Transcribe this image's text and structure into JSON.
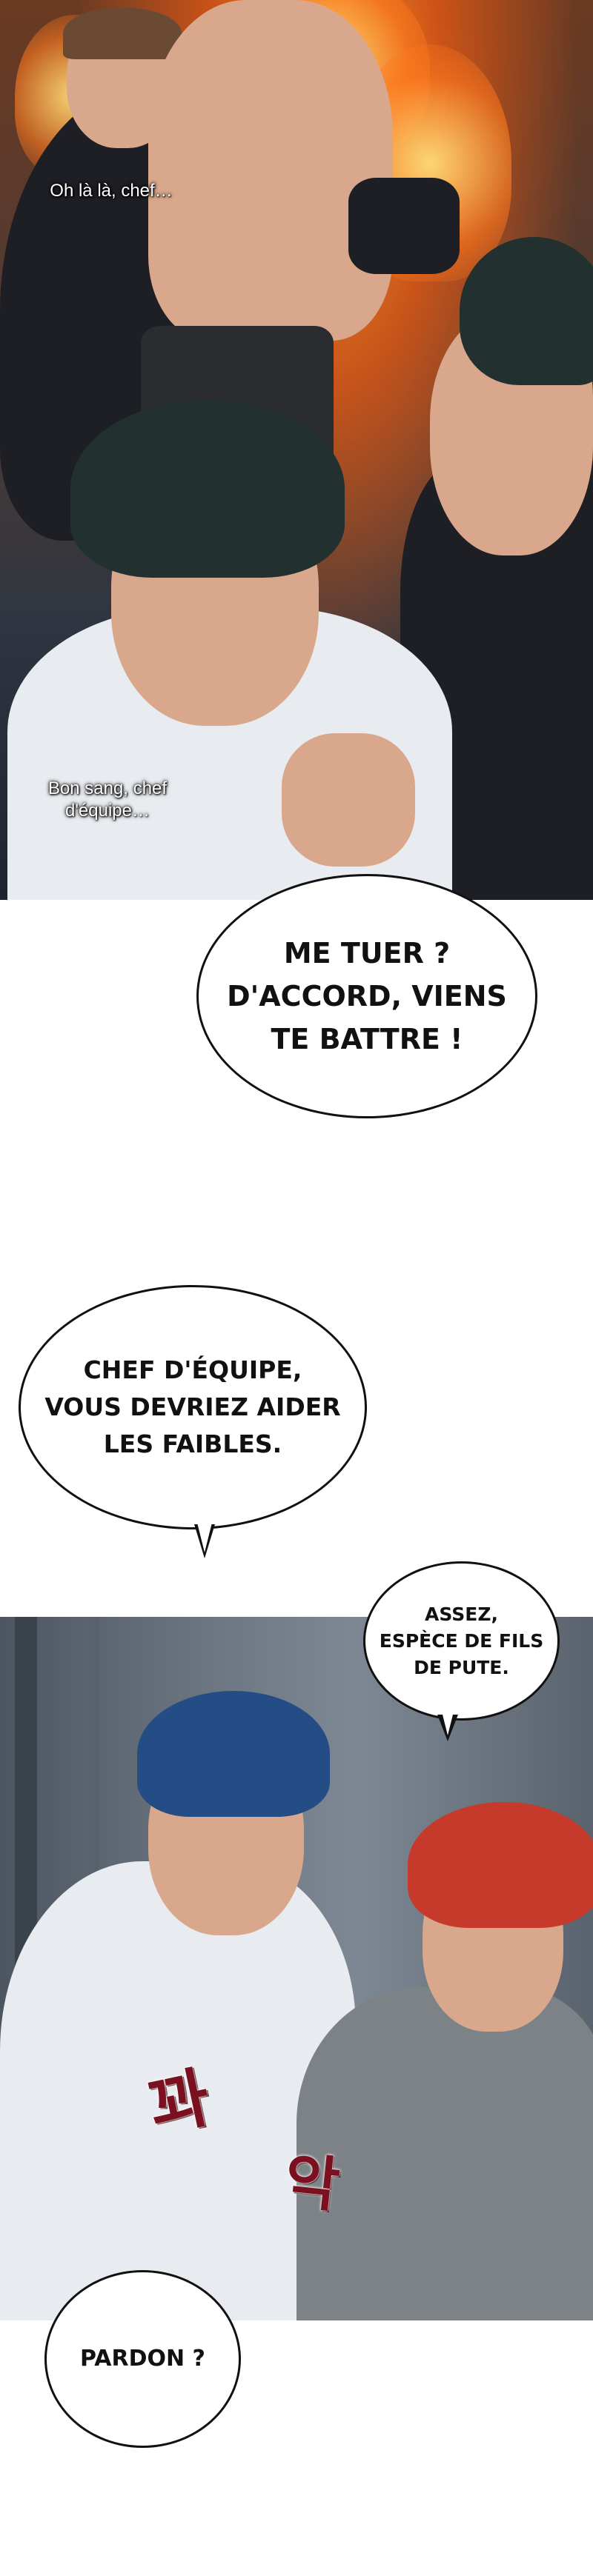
{
  "captions": {
    "oh_la_la": "Oh là là, chef…",
    "bon_sang": "Bon sang, chef\nd'équipe…"
  },
  "bubbles": {
    "me_tuer": "ME TUER ?\nD'ACCORD, VIENS\nTE BATTRE !",
    "chef_equipe": "CHEF D'ÉQUIPE,\nVOUS DEVRIEZ AIDER\nLES FAIBLES.",
    "assez": "ASSEZ,\nESPÈCE DE FILS\nDE PUTE.",
    "pardon": "PARDON ?"
  },
  "sfx": {
    "first": "꽈",
    "second": "악"
  }
}
